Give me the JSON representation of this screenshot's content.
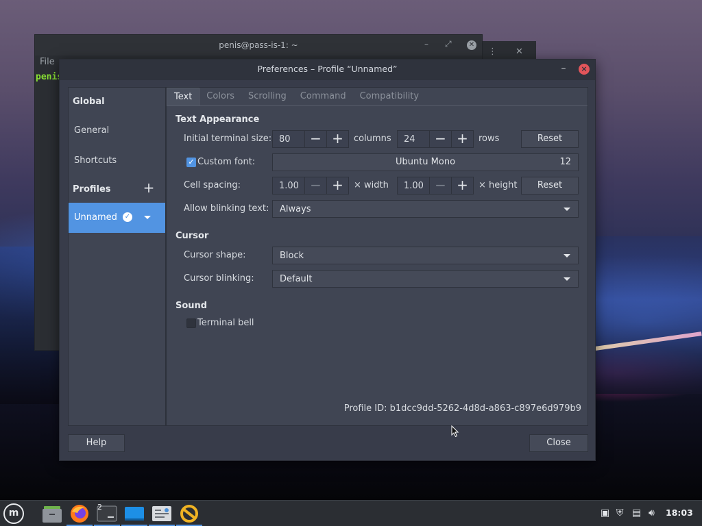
{
  "background_terminal": {
    "title": "penis@pass-is-1: ~",
    "menu_file": "File",
    "prompt": "penis"
  },
  "preferences": {
    "title": "Preferences – Profile “Unnamed”",
    "minimize_glyph": "–",
    "close_glyph": "×",
    "sidebar": {
      "global_header": "Global",
      "general": "General",
      "shortcuts": "Shortcuts",
      "profiles_header": "Profiles",
      "add_glyph": "+",
      "selected_profile": "Unnamed"
    },
    "tabs": [
      "Text",
      "Colors",
      "Scrolling",
      "Command",
      "Compatibility"
    ],
    "active_tab": "Text",
    "text_appearance": {
      "section": "Text Appearance",
      "initial_size_label": "Initial terminal size:",
      "columns_value": "80",
      "columns_unit": "columns",
      "rows_value": "24",
      "rows_unit": "rows",
      "reset_label": "Reset",
      "custom_font_label": "Custom font:",
      "custom_font_checked": true,
      "font_name": "Ubuntu Mono",
      "font_size": "12",
      "cell_spacing_label": "Cell spacing:",
      "width_value": "1.00",
      "width_unit": "× width",
      "height_value": "1.00",
      "height_unit": "× height",
      "blink_label": "Allow blinking text:",
      "blink_value": "Always"
    },
    "cursor": {
      "section": "Cursor",
      "shape_label": "Cursor shape:",
      "shape_value": "Block",
      "blinking_label": "Cursor blinking:",
      "blinking_value": "Default"
    },
    "sound": {
      "section": "Sound",
      "bell_label": "Terminal bell",
      "bell_checked": false
    },
    "profile_id_label": "Profile ID:",
    "profile_id": "b1dcc9dd-5262-4d8d-a863-c897e6d979b9",
    "help_label": "Help",
    "close_label": "Close"
  },
  "taskbar": {
    "menu_glyph": "m",
    "terminal_count": "2",
    "clock": "18:03",
    "icons": [
      "mint-menu-icon",
      "files-icon",
      "firefox-icon",
      "terminal-icon",
      "desktop-icon",
      "settings-icon",
      "update-manager-icon",
      "clipboard-icon",
      "shield-icon",
      "network-icon",
      "volume-icon"
    ]
  },
  "colors": {
    "accent": "#5294e2",
    "dialog_bg": "#383c4a",
    "panel_bg": "#404553",
    "close_red": "#e2555a"
  }
}
